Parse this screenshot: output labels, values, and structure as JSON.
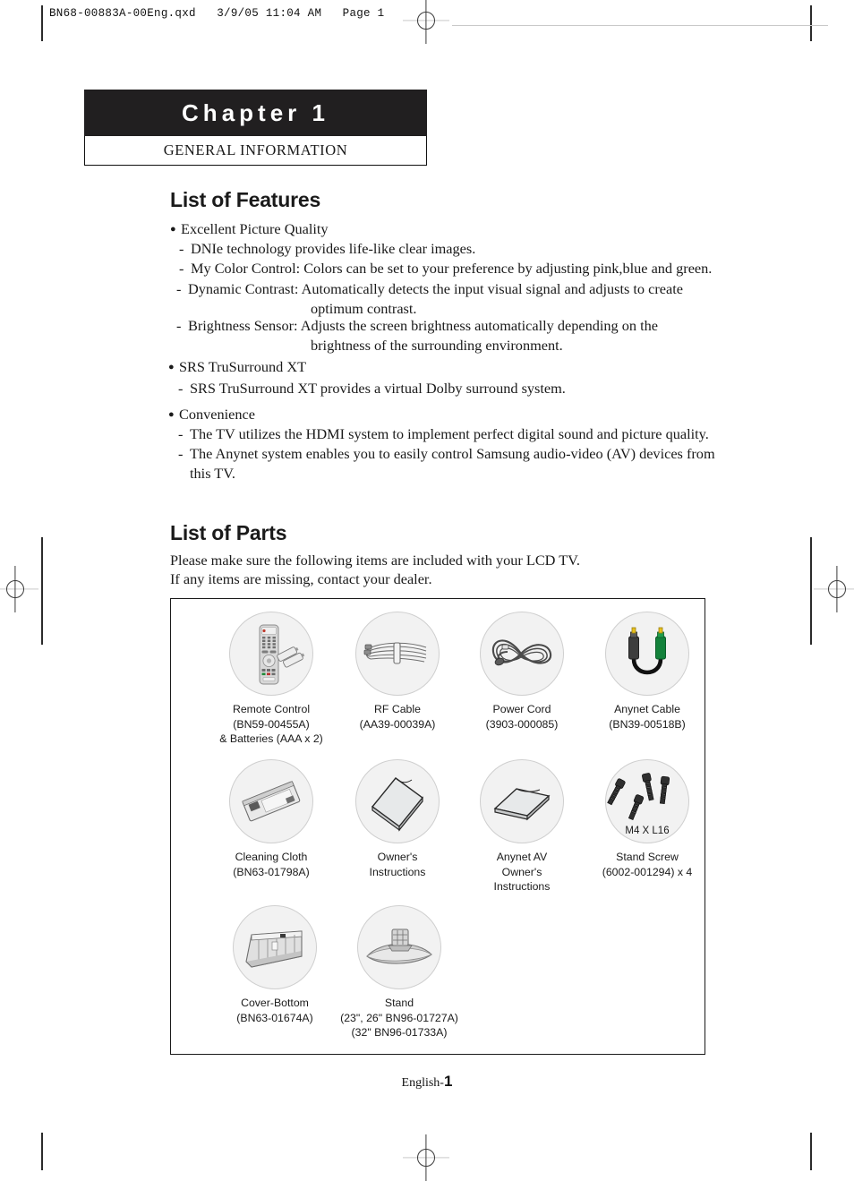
{
  "print_header": {
    "text": "BN68-00883A-00Eng.qxd   3/9/05 11:04 AM   Page 1"
  },
  "chapter": {
    "title": "Chapter 1",
    "subtitle_first": "G",
    "subtitle_rest": "ENERAL ",
    "subtitle_second": "I",
    "subtitle_rest2": "NFORMATION"
  },
  "features": {
    "heading": "List of Features",
    "groups": [
      {
        "bullet": "Excellent Picture Quality",
        "items": [
          {
            "text": "DNIe technology provides life-like clear images.",
            "cont": ""
          },
          {
            "text": "My Color Control: Colors can be set to your preference by adjusting pink,blue and green.",
            "cont": ""
          },
          {
            "text": "Dynamic Contrast: Automatically detects the input visual signal and adjusts to create",
            "cont": "optimum contrast."
          },
          {
            "text": "Brightness Sensor: Adjusts the screen brightness automatically depending on the",
            "cont": "brightness of the surrounding environment."
          }
        ]
      },
      {
        "bullet": "SRS TruSurround XT",
        "items": [
          {
            "text": "SRS TruSurround XT provides a virtual Dolby surround system.",
            "cont": ""
          }
        ]
      },
      {
        "bullet": "Convenience",
        "items": [
          {
            "text": "The TV utilizes the HDMI system to implement perfect digital sound and picture quality.",
            "cont": ""
          },
          {
            "text": "The Anynet system enables you to easily control Samsung audio-video (AV) devices from",
            "cont": "this TV."
          }
        ]
      }
    ]
  },
  "parts": {
    "heading": "List of Parts",
    "intro_line1": "Please make sure the following items are included with your LCD TV.",
    "intro_line2": "If any items are missing, contact your dealer.",
    "items": [
      {
        "icon": "remote-control-icon",
        "caption": "Remote Control\n(BN59-00455A)\n& Batteries (AAA x 2)"
      },
      {
        "icon": "rf-cable-icon",
        "caption": "RF Cable\n(AA39-00039A)"
      },
      {
        "icon": "power-cord-icon",
        "caption": "Power Cord\n(3903-000085)"
      },
      {
        "icon": "anynet-cable-icon",
        "caption": "Anynet Cable\n(BN39-00518B)"
      },
      {
        "icon": "cleaning-cloth-icon",
        "caption": "Cleaning Cloth\n(BN63-01798A)"
      },
      {
        "icon": "booklet-icon",
        "caption": "Owner's\nInstructions"
      },
      {
        "icon": "booklet-flat-icon",
        "caption": "Anynet AV\nOwner's\nInstructions"
      },
      {
        "icon": "stand-screw-icon",
        "caption": "Stand Screw\n(6002-001294) x 4",
        "inner_label": "M4 X L16"
      },
      {
        "icon": "cover-bottom-icon",
        "caption": "Cover-Bottom\n(BN63-01674A)"
      },
      {
        "icon": "stand-icon",
        "caption": "Stand\n(23\", 26\" BN96-01727A)\n(32\" BN96-01733A)"
      }
    ]
  },
  "footer": {
    "language": "English-",
    "page": "1"
  },
  "colors": {
    "chapter_bar": "#211f20",
    "circle_fill": "#f2f2f2",
    "circle_stroke": "#cfcfcf",
    "anynet_green": "#13823b",
    "anynet_black": "#3a3a3a",
    "connector_tip": "#e8c11c"
  }
}
